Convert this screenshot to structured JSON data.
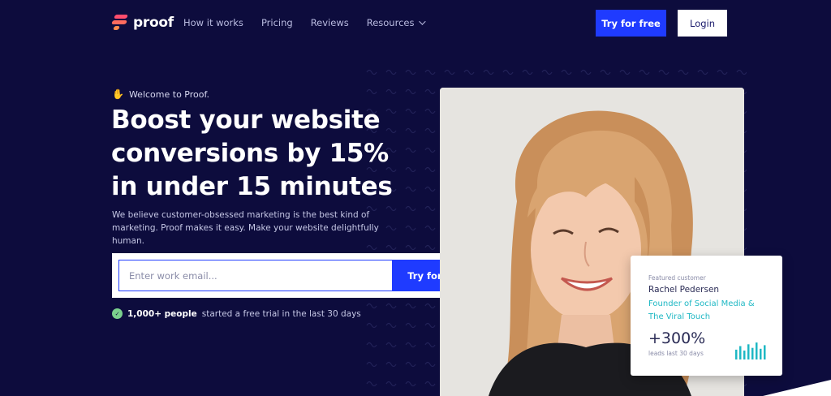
{
  "nav": {
    "brand": "proof",
    "links": [
      {
        "label": "How it works"
      },
      {
        "label": "Pricing"
      },
      {
        "label": "Reviews"
      },
      {
        "label": "Resources"
      }
    ],
    "try_label": "Try for free",
    "login_label": "Login"
  },
  "hero": {
    "welcome": "Welcome to Proof.",
    "headline": "Boost your website conversions by 15% in under 15 minutes",
    "subtext": "We believe customer-obsessed marketing is the best kind of marketing. Proof makes it easy. Make your website delightfully human.",
    "email_placeholder": "Enter work email...",
    "cta_label": "Try for free",
    "social_bold": "1,000+ people",
    "social_rest": "started a free trial in the last 30 days"
  },
  "card": {
    "featured": "Featured customer",
    "name": "Rachel Pedersen",
    "role": "Founder of Social Media & The Viral Touch",
    "stat": "+300%",
    "stat_label": "leads last 30 days",
    "bar_levels": [
      0.55,
      0.75,
      0.5,
      0.85,
      0.65,
      0.95,
      0.6,
      0.8
    ],
    "accent": "#1fb8c4"
  },
  "colors": {
    "background": "#0d0c3d",
    "primary": "#1f3bff",
    "logo": "#ff4d6d"
  }
}
